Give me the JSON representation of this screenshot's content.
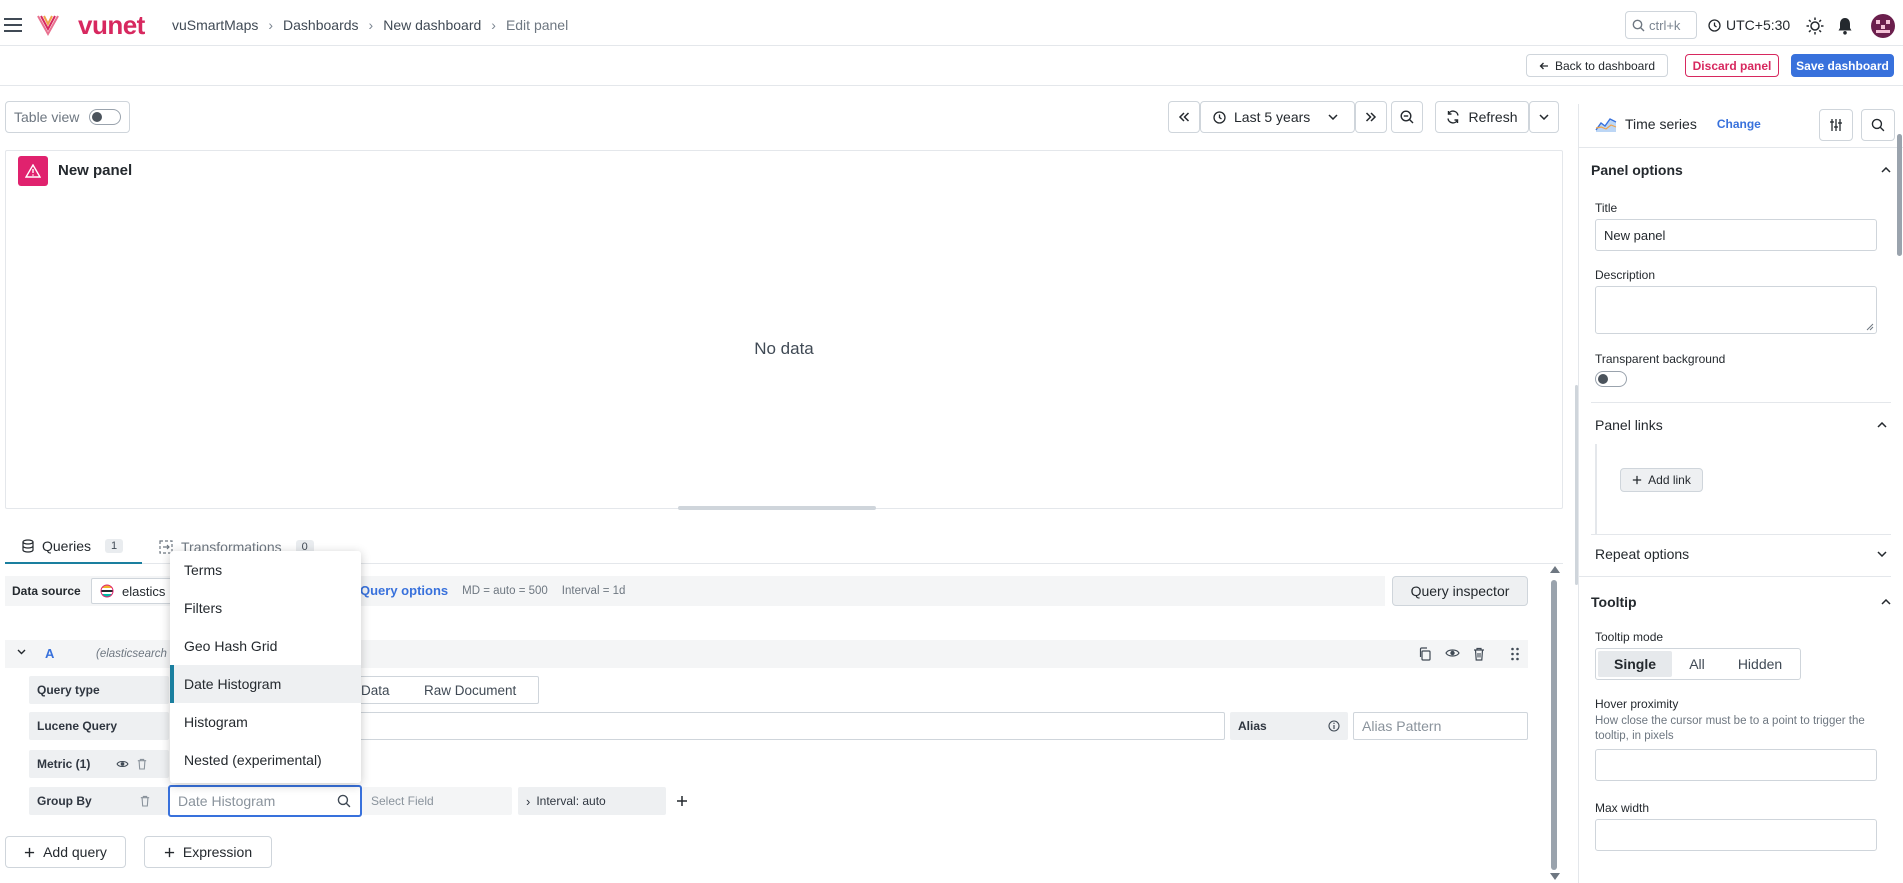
{
  "topbar": {
    "brand": "vunet",
    "breadcrumbs": [
      "vuSmartMaps",
      "Dashboards",
      "New dashboard"
    ],
    "breadcrumb_current": "Edit panel",
    "search_shortcut": "ctrl+k",
    "timezone": "UTC+5:30"
  },
  "actions": {
    "back": "Back to dashboard",
    "discard": "Discard panel",
    "save": "Save dashboard"
  },
  "toolbar": {
    "table_view_label": "Table view",
    "time_range": "Last 5 years",
    "refresh": "Refresh"
  },
  "panel": {
    "title": "New panel",
    "empty_text": "No data"
  },
  "query_tabs": [
    {
      "label": "Queries",
      "count": "1"
    },
    {
      "label": "Transformations",
      "count": "0"
    }
  ],
  "datasource": {
    "label": "Data source",
    "value": "elastics",
    "query_options_label": "Query options",
    "md": "MD = auto = 500",
    "interval": "Interval = 1d",
    "inspector": "Query inspector"
  },
  "query": {
    "ref": "A",
    "source_hint": "(elasticsearch",
    "query_type_label": "Query type",
    "query_type_options": [
      "Data",
      "Raw Document"
    ],
    "lucene_label": "Lucene Query",
    "alias_label": "Alias",
    "alias_placeholder": "Alias Pattern",
    "metric_label": "Metric (1)",
    "group_by_label": "Group By",
    "group_by_value": "Date Histogram",
    "select_field": "Select Field",
    "interval": "Interval: auto"
  },
  "dropdown": {
    "items": [
      "Terms",
      "Filters",
      "Geo Hash Grid",
      "Date Histogram",
      "Histogram",
      "Nested (experimental)"
    ],
    "active": "Date Histogram"
  },
  "bottom_buttons": {
    "add_query": "Add query",
    "expression": "Expression"
  },
  "options_pane": {
    "viz_name": "Time series",
    "change": "Change",
    "panel_options": "Panel options",
    "title_label": "Title",
    "title_value": "New panel",
    "description_label": "Description",
    "transparent_label": "Transparent background",
    "panel_links": "Panel links",
    "add_link": "Add link",
    "repeat_options": "Repeat options",
    "tooltip": "Tooltip",
    "tooltip_mode_label": "Tooltip mode",
    "tooltip_modes": [
      "Single",
      "All",
      "Hidden"
    ],
    "tooltip_mode_selected": "Single",
    "hover_label": "Hover proximity",
    "hover_desc": "How close the cursor must be to a point to trigger the tooltip, in pixels",
    "max_width_label": "Max width"
  },
  "colors": {
    "brand": "#d7285f",
    "primary": "#3871dc",
    "accent": "#1a7f9f"
  }
}
